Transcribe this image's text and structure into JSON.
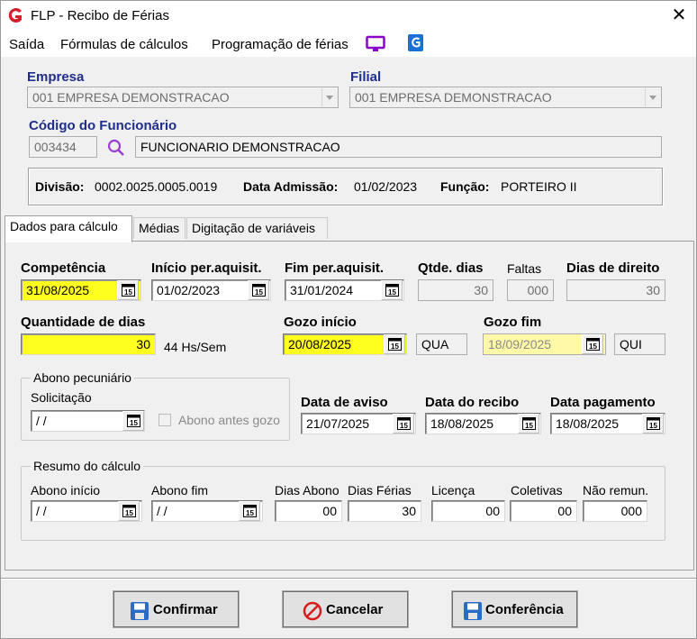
{
  "window": {
    "title": "FLP - Recibo de Férias",
    "close_glyph": "✕"
  },
  "menu": {
    "saida": "Saída",
    "formulas": "Fórmulas de cálculos",
    "programacao": "Programação de férias"
  },
  "empresa": {
    "label": "Empresa",
    "value": "001 EMPRESA DEMONSTRACAO"
  },
  "filial": {
    "label": "Filial",
    "value": "001 EMPRESA DEMONSTRACAO"
  },
  "funcionario": {
    "label": "Código do Funcionário",
    "code": "003434",
    "name": "FUNCIONARIO DEMONSTRACAO"
  },
  "info": {
    "divisao_label": "Divisão:",
    "divisao_value": "0002.0025.0005.0019",
    "admissao_label": "Data Admissão:",
    "admissao_value": "01/02/2023",
    "funcao_label": "Função:",
    "funcao_value": "PORTEIRO II"
  },
  "tabs": [
    "Dados para cálculo",
    "Médias",
    "Digitação de variáveis"
  ],
  "form": {
    "competencia": {
      "label": "Competência",
      "value": "31/08/2025"
    },
    "inicio_aquis": {
      "label": "Início per.aquisit.",
      "value": "01/02/2023"
    },
    "fim_aquis": {
      "label": "Fim per.aquisit.",
      "value": "31/01/2024"
    },
    "qtde_dias": {
      "label": "Qtde. dias",
      "value": "30"
    },
    "faltas": {
      "label": "Faltas",
      "value": "000"
    },
    "dias_direito": {
      "label": "Dias de direito",
      "value": "30"
    },
    "quantidade_dias": {
      "label": "Quantidade de dias",
      "value": "30",
      "hint": "44 Hs/Sem"
    },
    "gozo_inicio": {
      "label": "Gozo início",
      "value": "20/08/2025",
      "weekday": "QUA"
    },
    "gozo_fim": {
      "label": "Gozo fim",
      "value": "18/09/2025",
      "weekday": "QUI"
    },
    "abono": {
      "title": "Abono pecuniário",
      "solicitacao_label": "Solicitação",
      "solicitacao_value": " / /",
      "antes_gozo_label": "Abono antes gozo"
    },
    "data_aviso": {
      "label": "Data de aviso",
      "value": "21/07/2025"
    },
    "data_recibo": {
      "label": "Data do recibo",
      "value": "18/08/2025"
    },
    "data_pagamento": {
      "label": "Data pagamento",
      "value": "18/08/2025"
    }
  },
  "resumo": {
    "title": "Resumo do cálculo",
    "abono_inicio": {
      "label": "Abono início",
      "value": " / /"
    },
    "abono_fim": {
      "label": "Abono fim",
      "value": " / /"
    },
    "dias_abono": {
      "label": "Dias Abono",
      "value": "00"
    },
    "dias_ferias": {
      "label": "Dias Férias",
      "value": "30"
    },
    "licenca": {
      "label": "Licença",
      "value": "00"
    },
    "coletivas": {
      "label": "Coletivas",
      "value": "00"
    },
    "nao_remun": {
      "label": "Não remun.",
      "value": "000"
    }
  },
  "buttons": {
    "confirmar": "Confirmar",
    "cancelar": "Cancelar",
    "conferencia": "Conferência"
  },
  "colors": {
    "label_blue": "#1f2e8a",
    "highlight_yellow": "#ffff1e",
    "menu_icon_purple": "#8b00c9",
    "menu_icon_blue": "#1d6fd8",
    "cancel_red": "#d81b1b",
    "save_blue": "#2a6cc4"
  }
}
